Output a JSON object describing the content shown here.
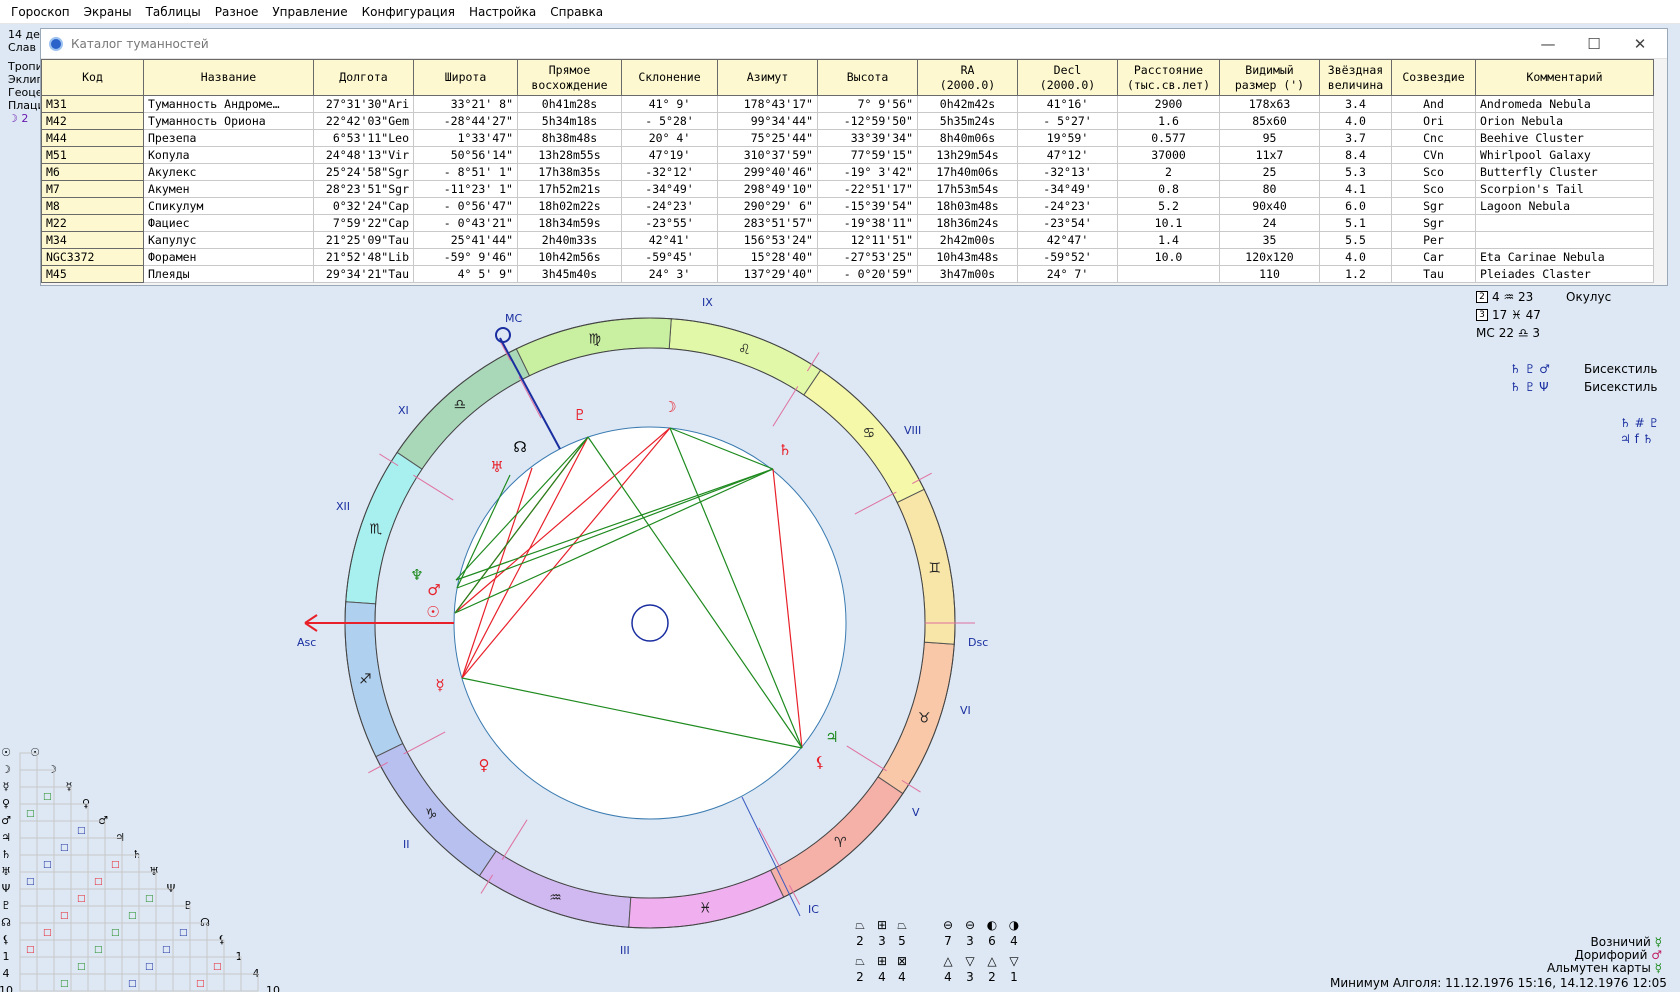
{
  "menu": [
    "Гороскоп",
    "Экраны",
    "Таблицы",
    "Разное",
    "Управление",
    "Конфигурация",
    "Настройка",
    "Справка"
  ],
  "left_info": {
    "line1": "14 де",
    "line2": "Слав",
    "line3": "Тропи",
    "line4": "Эклип",
    "line5": "Геоце",
    "line6": "Плаци",
    "line7": "☽ 2"
  },
  "catalog": {
    "title": "Каталог туманностей",
    "columns": [
      "Код",
      "Название",
      "Долгота",
      "Широта",
      "Прямое\nвосхождение",
      "Склонение",
      "Азимут",
      "Высота",
      "RA\n(2000.0)",
      "Decl\n(2000.0)",
      "Расстояние\n(тыс.св.лет)",
      "Видимый\nразмер (')",
      "Звёздная\nвеличина",
      "Созвездие",
      "Комментарий"
    ],
    "rows": [
      {
        "code": "M31",
        "name": "Туманность Андроме…",
        "lon": "27°31'30\"Ari",
        "lat": "33°21' 8\"",
        "ra": "0h41m28s",
        "dec": "41° 9'",
        "az": "178°43'17\"",
        "alt": "7° 9'56\"",
        "ra2000": "0h42m42s",
        "dec2000": "41°16'",
        "dist": "2900",
        "size": "178x63",
        "mag": "3.4",
        "const": "And",
        "comment": "Andromeda Nebula"
      },
      {
        "code": "M42",
        "name": "Туманность Ориона",
        "lon": "22°42'03\"Gem",
        "lat": "-28°44'27\"",
        "ra": "5h34m18s",
        "dec": "- 5°28'",
        "az": "99°34'44\"",
        "alt": "-12°59'50\"",
        "ra2000": "5h35m24s",
        "dec2000": "- 5°27'",
        "dist": "1.6",
        "size": "85x60",
        "mag": "4.0",
        "const": "Ori",
        "comment": "Orion Nebula"
      },
      {
        "code": "M44",
        "name": "Презепа",
        "lon": "6°53'11\"Leo",
        "lat": "1°33'47\"",
        "ra": "8h38m48s",
        "dec": "20° 4'",
        "az": "75°25'44\"",
        "alt": "33°39'34\"",
        "ra2000": "8h40m06s",
        "dec2000": "19°59'",
        "dist": "0.577",
        "size": "95",
        "mag": "3.7",
        "const": "Cnc",
        "comment": "Beehive Cluster"
      },
      {
        "code": "M51",
        "name": "Копула",
        "lon": "24°48'13\"Vir",
        "lat": "50°56'14\"",
        "ra": "13h28m55s",
        "dec": "47°19'",
        "az": "310°37'59\"",
        "alt": "77°59'15\"",
        "ra2000": "13h29m54s",
        "dec2000": "47°12'",
        "dist": "37000",
        "size": "11x7",
        "mag": "8.4",
        "const": "CVn",
        "comment": "Whirlpool Galaxy"
      },
      {
        "code": "M6",
        "name": "Акулекс",
        "lon": "25°24'58\"Sgr",
        "lat": "- 8°51' 1\"",
        "ra": "17h38m35s",
        "dec": "-32°12'",
        "az": "299°40'46\"",
        "alt": "-19° 3'42\"",
        "ra2000": "17h40m06s",
        "dec2000": "-32°13'",
        "dist": "2",
        "size": "25",
        "mag": "5.3",
        "const": "Sco",
        "comment": "Butterfly Cluster"
      },
      {
        "code": "M7",
        "name": "Акумен",
        "lon": "28°23'51\"Sgr",
        "lat": "-11°23' 1\"",
        "ra": "17h52m21s",
        "dec": "-34°49'",
        "az": "298°49'10\"",
        "alt": "-22°51'17\"",
        "ra2000": "17h53m54s",
        "dec2000": "-34°49'",
        "dist": "0.8",
        "size": "80",
        "mag": "4.1",
        "const": "Sco",
        "comment": "Scorpion's Tail"
      },
      {
        "code": "M8",
        "name": "Спикулум",
        "lon": "0°32'24\"Cap",
        "lat": "- 0°56'47\"",
        "ra": "18h02m22s",
        "dec": "-24°23'",
        "az": "290°29' 6\"",
        "alt": "-15°39'54\"",
        "ra2000": "18h03m48s",
        "dec2000": "-24°23'",
        "dist": "5.2",
        "size": "90x40",
        "mag": "6.0",
        "const": "Sgr",
        "comment": "Lagoon Nebula"
      },
      {
        "code": "M22",
        "name": "Фациес",
        "lon": "7°59'22\"Cap",
        "lat": "- 0°43'21\"",
        "ra": "18h34m59s",
        "dec": "-23°55'",
        "az": "283°51'57\"",
        "alt": "-19°38'11\"",
        "ra2000": "18h36m24s",
        "dec2000": "-23°54'",
        "dist": "10.1",
        "size": "24",
        "mag": "5.1",
        "const": "Sgr",
        "comment": ""
      },
      {
        "code": "M34",
        "name": "Капулус",
        "lon": "21°25'09\"Tau",
        "lat": "25°41'44\"",
        "ra": "2h40m33s",
        "dec": "42°41'",
        "az": "156°53'24\"",
        "alt": "12°11'51\"",
        "ra2000": "2h42m00s",
        "dec2000": "42°47'",
        "dist": "1.4",
        "size": "35",
        "mag": "5.5",
        "const": "Per",
        "comment": ""
      },
      {
        "code": "NGC3372",
        "name": "Форамен",
        "lon": "21°52'48\"Lib",
        "lat": "-59° 9'46\"",
        "ra": "10h42m56s",
        "dec": "-59°45'",
        "az": "15°28'40\"",
        "alt": "-27°53'25\"",
        "ra2000": "10h43m48s",
        "dec2000": "-59°52'",
        "dist": "10.0",
        "size": "120x120",
        "mag": "4.0",
        "const": "Car",
        "comment": "Eta Carinae Nebula"
      },
      {
        "code": "M45",
        "name": "Плеяды",
        "lon": "29°34'21\"Tau",
        "lat": "4° 5' 9\"",
        "ra": "3h45m40s",
        "dec": "24° 3'",
        "az": "137°29'40\"",
        "alt": "- 0°20'59\"",
        "ra2000": "3h47m00s",
        "dec2000": "24° 7'",
        "dist": "",
        "size": "110",
        "mag": "1.2",
        "const": "Tau",
        "comment": "Pleiades Claster"
      }
    ]
  },
  "chart": {
    "angle_labels": {
      "mc": "MC",
      "asc": "Asc",
      "dsc": "Dsc",
      "ic": "IC"
    },
    "house_labels": [
      "II",
      "III",
      "VI",
      "V",
      "VIII",
      "IX",
      "XI",
      "XII"
    ],
    "colors": {
      "aspect_red": "#e8202a",
      "aspect_green": "#1e8a1e",
      "axis_blue": "#1a2ea0"
    }
  },
  "right_aspects": [
    {
      "box": "2",
      "text": "4 ♒ 23",
      "label": "Окулус"
    },
    {
      "box": "3",
      "text": "17 ♓ 47",
      "label": ""
    },
    {
      "box": "MC",
      "text": "22 ♎ 3",
      "label": ""
    },
    {
      "box": "",
      "text": "♄ ♇ ♂",
      "label": "Бисекстиль"
    },
    {
      "box": "",
      "text": "♄ ♇ Ψ",
      "label": "Бисекстиль"
    }
  ],
  "right_symbols": [
    "♄ # ♇",
    "♃ f ♄"
  ],
  "bottom_right": {
    "line1_label": "Возничий",
    "line2_label": "Дорифорий",
    "line3_label": "Альмутен карты",
    "algol": "Минимум Алголя: 11.12.1976 15:16,  14.12.1976 12:05"
  },
  "geo_legend": {
    "top_numbers": [
      "2",
      "3",
      "5",
      "7",
      "3",
      "6",
      "4"
    ],
    "bottom_numbers": [
      "2",
      "4",
      "4",
      "4",
      "3",
      "2",
      "1"
    ]
  },
  "aspect_grid_rows": [
    "☉",
    "☽",
    "☿",
    "♀",
    "♂",
    "♃",
    "♄",
    "♅",
    "Ψ",
    "♇",
    "☊",
    "⚸",
    "1",
    "4",
    "10"
  ]
}
